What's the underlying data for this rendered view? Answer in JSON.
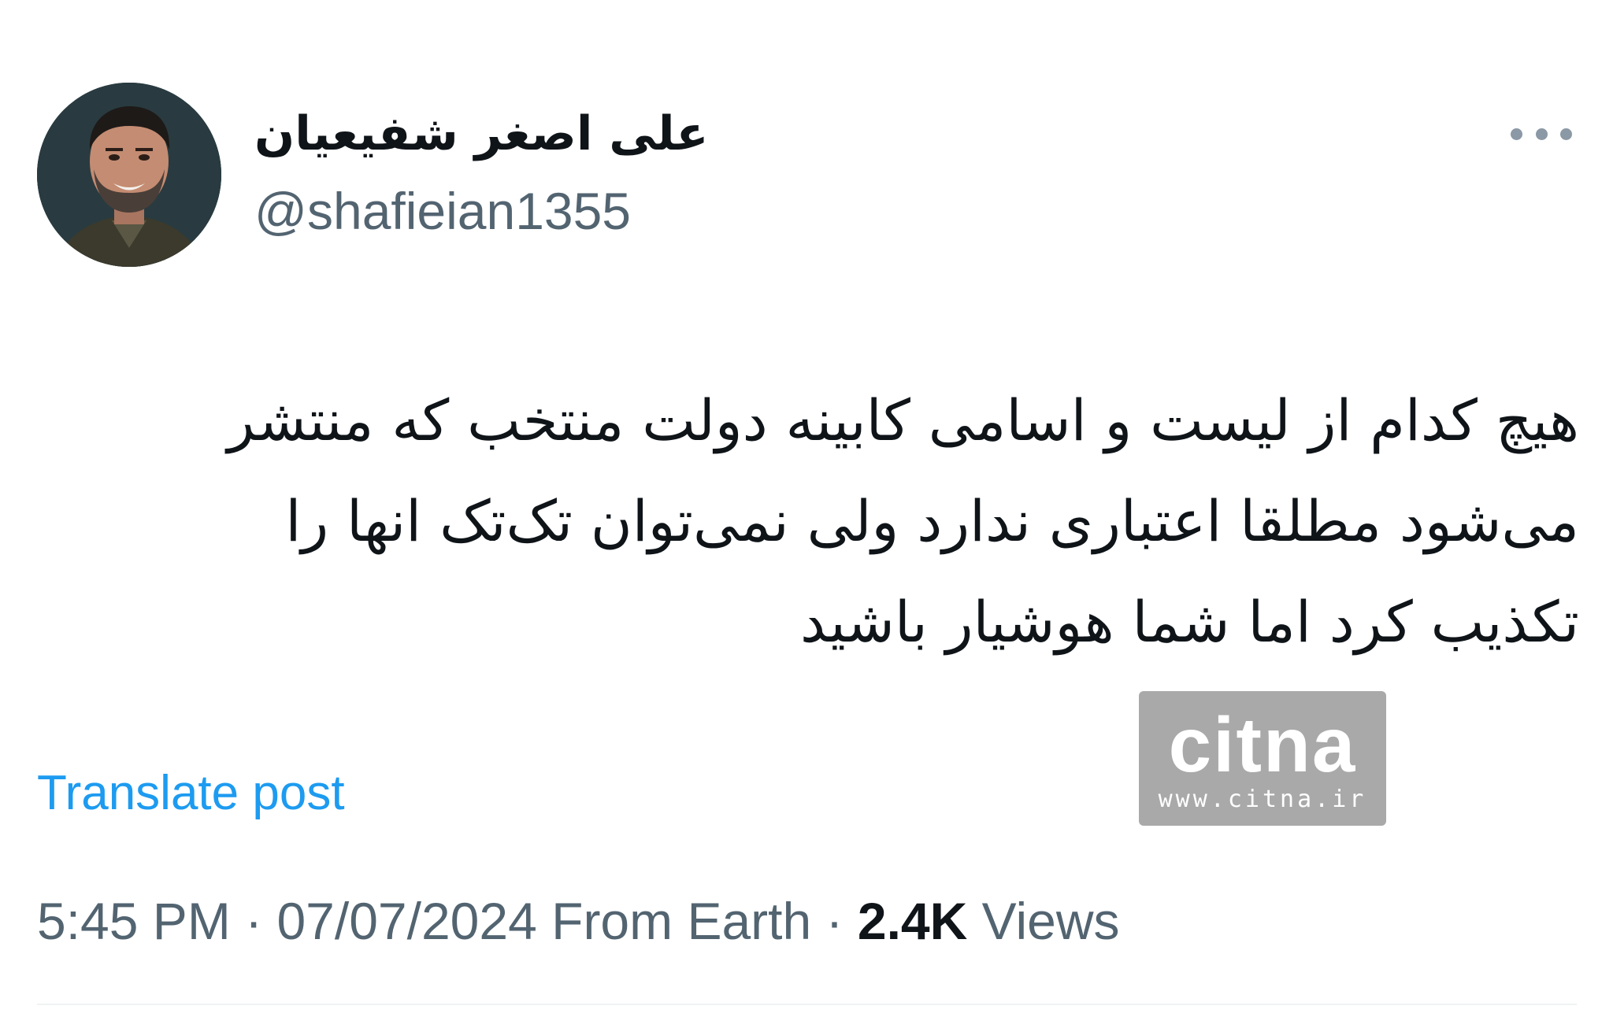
{
  "author": {
    "display_name": "علی اصغر شفیعیان",
    "handle": "@shafieian1355"
  },
  "tweet": {
    "text": "هیچ کدام از لیست و اسامی کابینه دولت منتخب که منتشر\nمی‌شود مطلقا اعتباری ندارد ولی نمی‌توان تک‌تک انها را\nتکذیب کرد اما شما هوشیار باشید"
  },
  "watermark": {
    "logo_text": "citna",
    "url": "www.citna.ir"
  },
  "actions": {
    "translate_label": "Translate post",
    "more_icon": "more-horizontal-icon"
  },
  "meta": {
    "time": "5:45 PM",
    "separator": " · ",
    "date": "07/07/2024",
    "source": "From Earth",
    "views_count": "2.4K",
    "views_label": "Views"
  },
  "colors": {
    "text_primary": "#0f1419",
    "text_secondary": "#536471",
    "link": "#1d9bf0",
    "watermark_bg": "#a9a9a9",
    "divider": "#eff3f4"
  }
}
